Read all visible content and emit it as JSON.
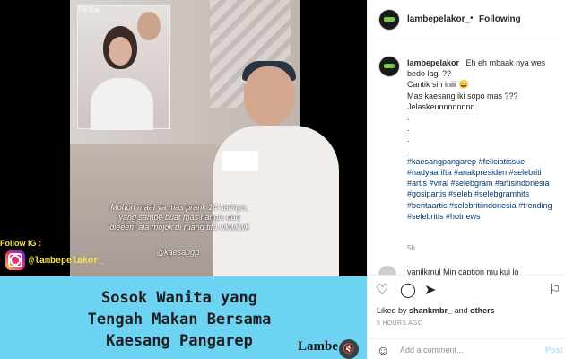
{
  "media": {
    "tiktok_label": "TikTok",
    "overlay_caption": "Mohon maaf ya mas prank 14 harinya, yang sampe buat mas nangis dan dieeem aja mojok di ruang tifa wkwkwk",
    "overlay_tag": "@kaesangp",
    "follow_label": "Follow IG :",
    "ig_handle": "@lambepelakor_",
    "banner_lines": [
      "Sosok Wanita yang",
      "Tengah Makan Bersama",
      "Kaesang Pangarep"
    ],
    "banner_logo": "Lambe",
    "mute_icon": "speaker-muted-icon"
  },
  "header": {
    "username": "lambepelakor_",
    "dot": "•",
    "follow_status": "Following"
  },
  "caption": {
    "username": "lambepelakor_",
    "lines": [
      "Eh eh mbaak nya wes bedo lagi ??",
      "Cantik sih iniii 😄",
      "Mas kaesang iki sopo mas ???",
      "Jelaskeunnnnnnnn",
      ".",
      ".",
      ".",
      "."
    ],
    "hashtags": "#kaesangpangarep #feliciatissue #nadyaarifta #anakpresiden #selebriti #artis #viral #selebgram #artisindonesia #gosipartis #seleb #selebgramhits #beritaartis #selebritiindonesia #trending #selebritis #hotnews",
    "time": "5h"
  },
  "second_comment": {
    "text": "vanilkmul Min caption mu kui lo"
  },
  "actions": {
    "liked_prefix": "Liked by",
    "liked_user": "shankmbr_",
    "liked_and": "and",
    "liked_others": "others",
    "post_time": "5 HOURS AGO",
    "comment_placeholder": "Add a comment...",
    "post_label": "Post"
  },
  "colors": {
    "banner": "#6dd3f2",
    "hashtag": "#00376b",
    "post_button": "#b2dffc"
  }
}
